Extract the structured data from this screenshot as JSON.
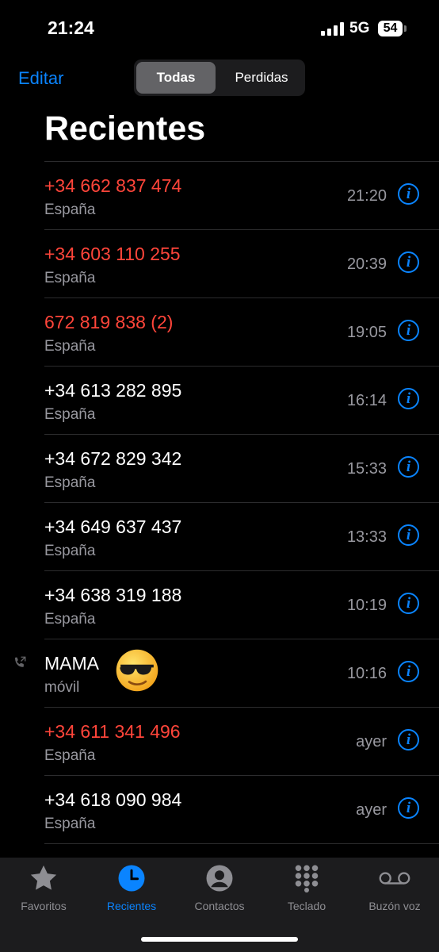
{
  "status": {
    "time": "21:24",
    "network": "5G",
    "battery": "54"
  },
  "header": {
    "edit_label": "Editar",
    "title": "Recientes",
    "segments": [
      {
        "label": "Todas",
        "active": true
      },
      {
        "label": "Perdidas",
        "active": false
      }
    ]
  },
  "calls": [
    {
      "name": "+34 662 837 474",
      "sub": "España",
      "time": "21:20",
      "missed": true
    },
    {
      "name": "+34 603 110 255",
      "sub": "España",
      "time": "20:39",
      "missed": true
    },
    {
      "name": "672 819 838 (2)",
      "sub": "España",
      "time": "19:05",
      "missed": true
    },
    {
      "name": "+34 613 282 895",
      "sub": "España",
      "time": "16:14",
      "missed": false
    },
    {
      "name": "+34 672 829 342",
      "sub": "España",
      "time": "15:33",
      "missed": false
    },
    {
      "name": "+34 649 637 437",
      "sub": "España",
      "time": "13:33",
      "missed": false
    },
    {
      "name": "+34 638 319 188",
      "sub": "España",
      "time": "10:19",
      "missed": false
    },
    {
      "name": "MAMA",
      "sub": "móvil",
      "time": "10:16",
      "missed": false,
      "outgoing": true,
      "emoji": "smiling-face-with-sunglasses"
    },
    {
      "name": "+34 611 341 496",
      "sub": "España",
      "time": "ayer",
      "missed": true
    },
    {
      "name": "+34 618 090 984",
      "sub": "España",
      "time": "ayer",
      "missed": false
    }
  ],
  "tabs": [
    {
      "label": "Favoritos",
      "icon": "star-icon",
      "active": false
    },
    {
      "label": "Recientes",
      "icon": "clock-icon",
      "active": true
    },
    {
      "label": "Contactos",
      "icon": "person-circle-icon",
      "active": false
    },
    {
      "label": "Teclado",
      "icon": "keypad-icon",
      "active": false
    },
    {
      "label": "Buzón voz",
      "icon": "voicemail-icon",
      "active": false
    }
  ],
  "colors": {
    "accent": "#0a84ff",
    "missed": "#ff453a",
    "secondary": "#98989f",
    "background": "#000000"
  }
}
